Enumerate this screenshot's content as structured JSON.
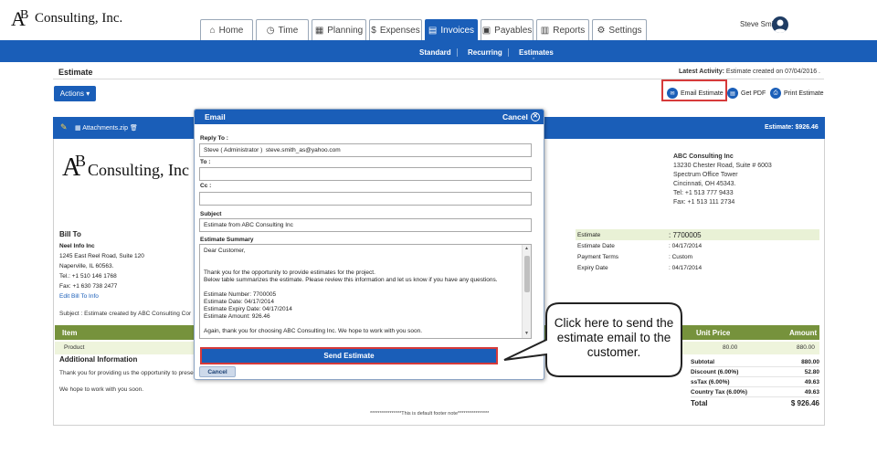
{
  "app": {
    "logo_text": "Consulting, Inc.",
    "user_name": "Steve Smith"
  },
  "nav": {
    "tabs": [
      {
        "label": "Home",
        "icon": "home-icon"
      },
      {
        "label": "Time",
        "icon": "clock-icon"
      },
      {
        "label": "Planning",
        "icon": "calendar-icon"
      },
      {
        "label": "Expenses",
        "icon": "dollar-icon"
      },
      {
        "label": "Invoices",
        "icon": "document-icon",
        "active": true
      },
      {
        "label": "Payables",
        "icon": "money-icon"
      },
      {
        "label": "Reports",
        "icon": "chart-icon"
      },
      {
        "label": "Settings",
        "icon": "gears-icon"
      }
    ],
    "subtabs": [
      "Standard",
      "Recurring",
      "Estimates"
    ]
  },
  "page": {
    "title": "Estimate",
    "latest_label": "Latest Activity:",
    "latest_value": "Estimate created on 07/04/2016 .",
    "actions_label": "Actions",
    "email_estimate": "Email Estimate",
    "get_pdf": "Get PDF",
    "print_estimate": "Print Estimate"
  },
  "estimate": {
    "attachments": "Attachments.zip",
    "bar_total": "Estimate: $926.46",
    "logo_text": "Consulting, Inc",
    "company": [
      "ABC Consulting Inc",
      "13230 Chester Road, Suite # 6003",
      "Spectrum Office Tower",
      "Cincinnati, OH 45343.",
      "Tel: +1 513 777 9433",
      "Fax: +1 513 111 2734"
    ],
    "bill_to_heading": "Bill To",
    "bill_to": [
      "Neel Info Inc",
      "1245 East Reel Road, Suite 120",
      "Naperville, IL 60563.",
      "Tel.: +1 510 146 1768",
      "Fax: +1 630 738 2477"
    ],
    "edit_bill_to": "Edit Bill To Info",
    "subject": "Subject : Estimate created by ABC Consulting Cor",
    "meta": [
      {
        "key": "Estimate",
        "value": ": 7700005"
      },
      {
        "key": "Estimate Date",
        "value": ": 04/17/2014"
      },
      {
        "key": "Payment Terms",
        "value": ": Custom"
      },
      {
        "key": "Expiry Date",
        "value": ": 04/17/2014"
      }
    ],
    "item_header": {
      "item": "Item",
      "unit_price": "Unit Price",
      "amount": "Amount"
    },
    "item_row": {
      "name": "Product",
      "unit_price": "80.00",
      "amount": "880.00"
    },
    "additional_heading": "Additional Information",
    "additional_1": "Thank you for providing us the opportunity to prese",
    "additional_2": "We hope to work with you soon.",
    "totals": [
      {
        "label": "Subtotal",
        "value": "880.00"
      },
      {
        "label": "Discount (6.00%)",
        "value": "52.80"
      },
      {
        "label": "ssTax (6.00%)",
        "value": "49.63"
      },
      {
        "label": "Country Tax (6.00%)",
        "value": "49.63"
      },
      {
        "label": "Total",
        "value": "$ 926.46"
      }
    ],
    "footer_note": "****************This is default footer note****************"
  },
  "email_modal": {
    "title": "Email",
    "cancel_label": "Cancel",
    "reply_to_label": "Reply To :",
    "reply_to_value": "Steve ( Administrator )  steve.smith_as@yahoo.com",
    "to_label": "To :",
    "to_value": "",
    "cc_label": "Cc :",
    "cc_value": "",
    "subject_label": "Subject",
    "subject_value": "Estimate from ABC Consulting Inc",
    "summary_label": "Estimate Summary",
    "summary_text": "Dear Customer,\n\n\nThank you for the opportunity to provide estimates for the project.\nBelow table summarizes the estimate.  Please review this information and let us know if you have any questions.\n\nEstimate Number:  7700005\nEstimate Date: 04/17/2014\nEstimate Expiry Date: 04/17/2014\nEstimate Amount: 926.46\n\nAgain, thank you for choosing  ABC Consulting Inc. We hope to work with you soon.",
    "send_label": "Send Estimate",
    "cancel_button": "Cancel"
  },
  "callout": {
    "text": "Click here to send the estimate email to the customer."
  },
  "colors": {
    "primary": "#1a5eb8",
    "highlight": "#d63a3a",
    "table_header": "#76923c"
  }
}
